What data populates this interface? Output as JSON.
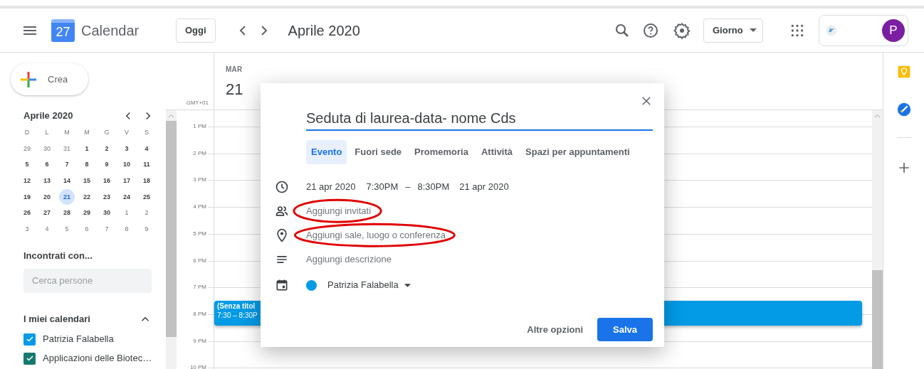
{
  "header": {
    "logo_day": "27",
    "app_name": "Calendar",
    "today_button": "Oggi",
    "period": "Aprile 2020",
    "view_select": "Giorno",
    "avatar_letter": "P"
  },
  "sidebar": {
    "create_button": "Crea",
    "mini_calendar": {
      "title": "Aprile 2020",
      "weekdays": [
        "D",
        "L",
        "M",
        "M",
        "G",
        "V",
        "S"
      ],
      "weeks": [
        [
          {
            "day": "29",
            "dim": true,
            "selected": false
          },
          {
            "day": "30",
            "dim": true,
            "selected": false
          },
          {
            "day": "31",
            "dim": true,
            "selected": false
          },
          {
            "day": "1",
            "dim": false,
            "selected": false
          },
          {
            "day": "2",
            "dim": false,
            "selected": false
          },
          {
            "day": "3",
            "dim": false,
            "selected": false
          },
          {
            "day": "4",
            "dim": false,
            "selected": false
          }
        ],
        [
          {
            "day": "5",
            "dim": false,
            "selected": false
          },
          {
            "day": "6",
            "dim": false,
            "selected": false
          },
          {
            "day": "7",
            "dim": false,
            "selected": false
          },
          {
            "day": "8",
            "dim": false,
            "selected": false
          },
          {
            "day": "9",
            "dim": false,
            "selected": false
          },
          {
            "day": "10",
            "dim": false,
            "selected": false
          },
          {
            "day": "11",
            "dim": false,
            "selected": false
          }
        ],
        [
          {
            "day": "12",
            "dim": false,
            "selected": false
          },
          {
            "day": "13",
            "dim": false,
            "selected": false
          },
          {
            "day": "14",
            "dim": false,
            "selected": false
          },
          {
            "day": "15",
            "dim": false,
            "selected": false
          },
          {
            "day": "16",
            "dim": false,
            "selected": false
          },
          {
            "day": "17",
            "dim": false,
            "selected": false
          },
          {
            "day": "18",
            "dim": false,
            "selected": false
          }
        ],
        [
          {
            "day": "19",
            "dim": false,
            "selected": false
          },
          {
            "day": "20",
            "dim": false,
            "selected": false
          },
          {
            "day": "21",
            "dim": false,
            "selected": true
          },
          {
            "day": "22",
            "dim": false,
            "selected": false
          },
          {
            "day": "23",
            "dim": false,
            "selected": false
          },
          {
            "day": "24",
            "dim": false,
            "selected": false
          },
          {
            "day": "25",
            "dim": false,
            "selected": false
          }
        ],
        [
          {
            "day": "26",
            "dim": false,
            "selected": false
          },
          {
            "day": "27",
            "dim": false,
            "selected": false
          },
          {
            "day": "28",
            "dim": false,
            "selected": false
          },
          {
            "day": "29",
            "dim": false,
            "selected": false
          },
          {
            "day": "30",
            "dim": false,
            "selected": false
          },
          {
            "day": "1",
            "dim": true,
            "selected": false
          },
          {
            "day": "2",
            "dim": true,
            "selected": false
          }
        ],
        [
          {
            "day": "3",
            "dim": true,
            "selected": false
          },
          {
            "day": "4",
            "dim": true,
            "selected": false
          },
          {
            "day": "5",
            "dim": true,
            "selected": false
          },
          {
            "day": "6",
            "dim": true,
            "selected": false
          },
          {
            "day": "7",
            "dim": true,
            "selected": false
          },
          {
            "day": "8",
            "dim": true,
            "selected": false
          },
          {
            "day": "9",
            "dim": true,
            "selected": false
          }
        ]
      ]
    },
    "meet_with": {
      "title": "Incontrati con...",
      "search_placeholder": "Cerca persone"
    },
    "my_calendars": {
      "title": "I miei calendari",
      "expanded": true,
      "items": [
        {
          "name": "Patrizia Falabella",
          "checked": true,
          "color": "#039be5"
        },
        {
          "name": "Applicazioni delle Biotec…",
          "checked": true,
          "color": "#16796f"
        }
      ]
    }
  },
  "day_view": {
    "weekday": "MAR",
    "date": "21",
    "timezone": "GMT+01",
    "hours": [
      "1 PM",
      "2 PM",
      "3 PM",
      "4 PM",
      "5 PM",
      "6 PM",
      "7 PM",
      "8 PM",
      "9 PM",
      "10 PM"
    ],
    "event": {
      "title": "(Senza titol",
      "time": "7:30 – 8:30P"
    }
  },
  "dialog": {
    "title_value": "Seduta di laurea-data- nome Cds",
    "tabs": [
      {
        "label": "Evento",
        "selected": true
      },
      {
        "label": "Fuori sede",
        "selected": false
      },
      {
        "label": "Promemoria",
        "selected": false
      },
      {
        "label": "Attività",
        "selected": false
      },
      {
        "label": "Spazi per appuntamenti",
        "selected": false
      }
    ],
    "when": {
      "start_date": "21 apr 2020",
      "start_time": "7:30PM",
      "separator": "–",
      "end_time": "8:30PM",
      "end_date": "21 apr 2020"
    },
    "fields": [
      {
        "kind": "guests",
        "text": "Aggiungi invitati",
        "circled": true
      },
      {
        "kind": "location",
        "text": "Aggiungi sale, luogo o conferenza",
        "circled": true
      },
      {
        "kind": "description",
        "text": "Aggiungi descrizione",
        "circled": false
      }
    ],
    "calendar": {
      "name": "Patrizia Falabella",
      "color": "#039be5"
    },
    "more_button": "Altre opzioni",
    "save_button": "Salva"
  }
}
